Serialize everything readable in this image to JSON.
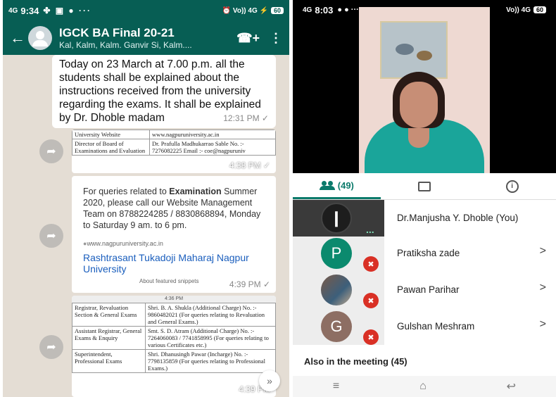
{
  "whatsapp": {
    "status": {
      "signal": "4G",
      "time": "9:34",
      "icons": "✤ ▣ ● ···",
      "right": "⏰ Vo)) 4G ⚡",
      "battery": "60"
    },
    "header": {
      "back_icon": "←",
      "title": "IGCK BA Final 20-21",
      "subtitle": "Kal, Kalm, Kalm. Ganvir Si, Kalm....",
      "call_icon": "☎+",
      "menu_icon": "⋮"
    },
    "message1": {
      "text": "Today on 23 March at 7.00 p.m. all the students shall be explained about the instructions received from the university regarding the exams. It shall be explained by Dr. Dhoble madam",
      "time": "12:31 PM ✓"
    },
    "image1": {
      "rows": [
        [
          "University Website",
          "www.nagpuruniversity.ac.in"
        ],
        [
          "Director of Board of Examinations and Evaluation",
          "Dr. Prafulla Madhukarrao Sable No. :- 7276082225 Email :- coe@nagpuruniv"
        ]
      ],
      "time": "4:38 PM ✓"
    },
    "image2": {
      "text_pre": "For queries related to ",
      "text_bold": "Examination",
      "text_post": " Summer 2020, please call our Website Management Team on 8788224285 / 8830868894, Monday to Saturday 9 am. to 6 pm.",
      "site": "www.nagpuruniversity.ac.in",
      "link": "Rashtrasant Tukadoji Maharaj Nagpur University",
      "about": "About featured snippets",
      "time": "4:39 PM ✓"
    },
    "image3": {
      "bar": "4:36 PM",
      "rows": [
        [
          "Registrar, Revaluation Section & General Exams",
          "Shri. B. A. Shukla (Additional Charge) No. :- 9860482021 (For queries relating to Revaluation and General Exams.)"
        ],
        [
          "Assistant Registrar, General Exams & Enquiry",
          "Smt. S. D. Atram (Additional Charge) No. :- 7264060083 / 7741858995 (For queries relating to various Certificates etc.)"
        ],
        [
          "Superintendent, Professional Exams",
          "Shri. Dhanusingh Pawar (Incharge) No. :- 7798135859 (For queries relating to Professional Exams.)"
        ]
      ],
      "time": "4:39 PM"
    },
    "forward_icon": "➦",
    "scroll_icon": "»"
  },
  "meet": {
    "status": {
      "signal": "4G",
      "time": "8:03",
      "icons": "● ● ···",
      "right": "Vo)) 4G",
      "battery": "60"
    },
    "tabs": {
      "people_count": "(49)"
    },
    "participants": [
      {
        "name": "Dr.Manjusha Y. Dhoble (You)",
        "avatar": "❙"
      },
      {
        "name": "Pratiksha zade",
        "avatar": "P"
      },
      {
        "name": "Pawan Parihar",
        "avatar": ""
      },
      {
        "name": "Gulshan Meshram",
        "avatar": "G"
      }
    ],
    "mute_icon": "✖",
    "chevron": ">",
    "more_dots": "...",
    "also_label": "Also in the meeting (45)",
    "nav": {
      "menu": "≡",
      "home": "⌂",
      "back": "↩"
    }
  }
}
